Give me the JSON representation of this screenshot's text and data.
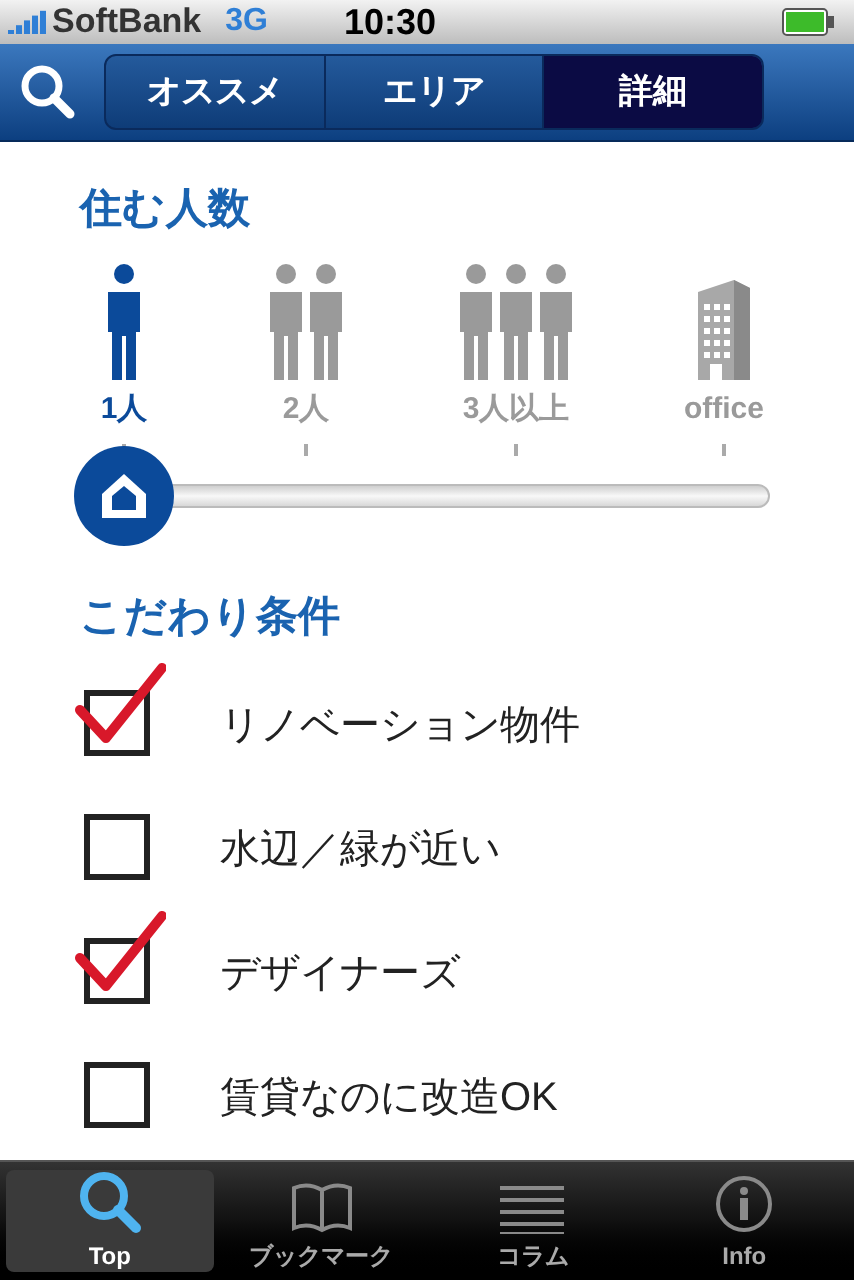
{
  "status_bar": {
    "carrier": "SoftBank",
    "network": "3G",
    "time": "10:30"
  },
  "segments": [
    {
      "label": "オススメ",
      "selected": false
    },
    {
      "label": "エリア",
      "selected": false
    },
    {
      "label": "詳細",
      "selected": true
    }
  ],
  "occupants": {
    "title": "住む人数",
    "options": [
      {
        "kind": "one",
        "label": "1人",
        "selected": true
      },
      {
        "kind": "two",
        "label": "2人",
        "selected": false
      },
      {
        "kind": "three",
        "label": "3人以上",
        "selected": false
      },
      {
        "kind": "building",
        "label": "office",
        "selected": false
      }
    ],
    "level": 0
  },
  "conditions": {
    "title": "こだわり条件",
    "items": [
      {
        "label": "リノベーション物件",
        "checked": true
      },
      {
        "label": "水辺／緑が近い",
        "checked": false
      },
      {
        "label": "デザイナーズ",
        "checked": true
      },
      {
        "label": "賃貸なのに改造OK",
        "checked": false
      }
    ]
  },
  "tab_bar": [
    {
      "kind": "search",
      "label": "Top",
      "selected": true
    },
    {
      "kind": "book",
      "label": "ブックマーク",
      "selected": false
    },
    {
      "kind": "lines",
      "label": "コラム",
      "selected": false
    },
    {
      "kind": "info",
      "label": "Info",
      "selected": false
    }
  ]
}
